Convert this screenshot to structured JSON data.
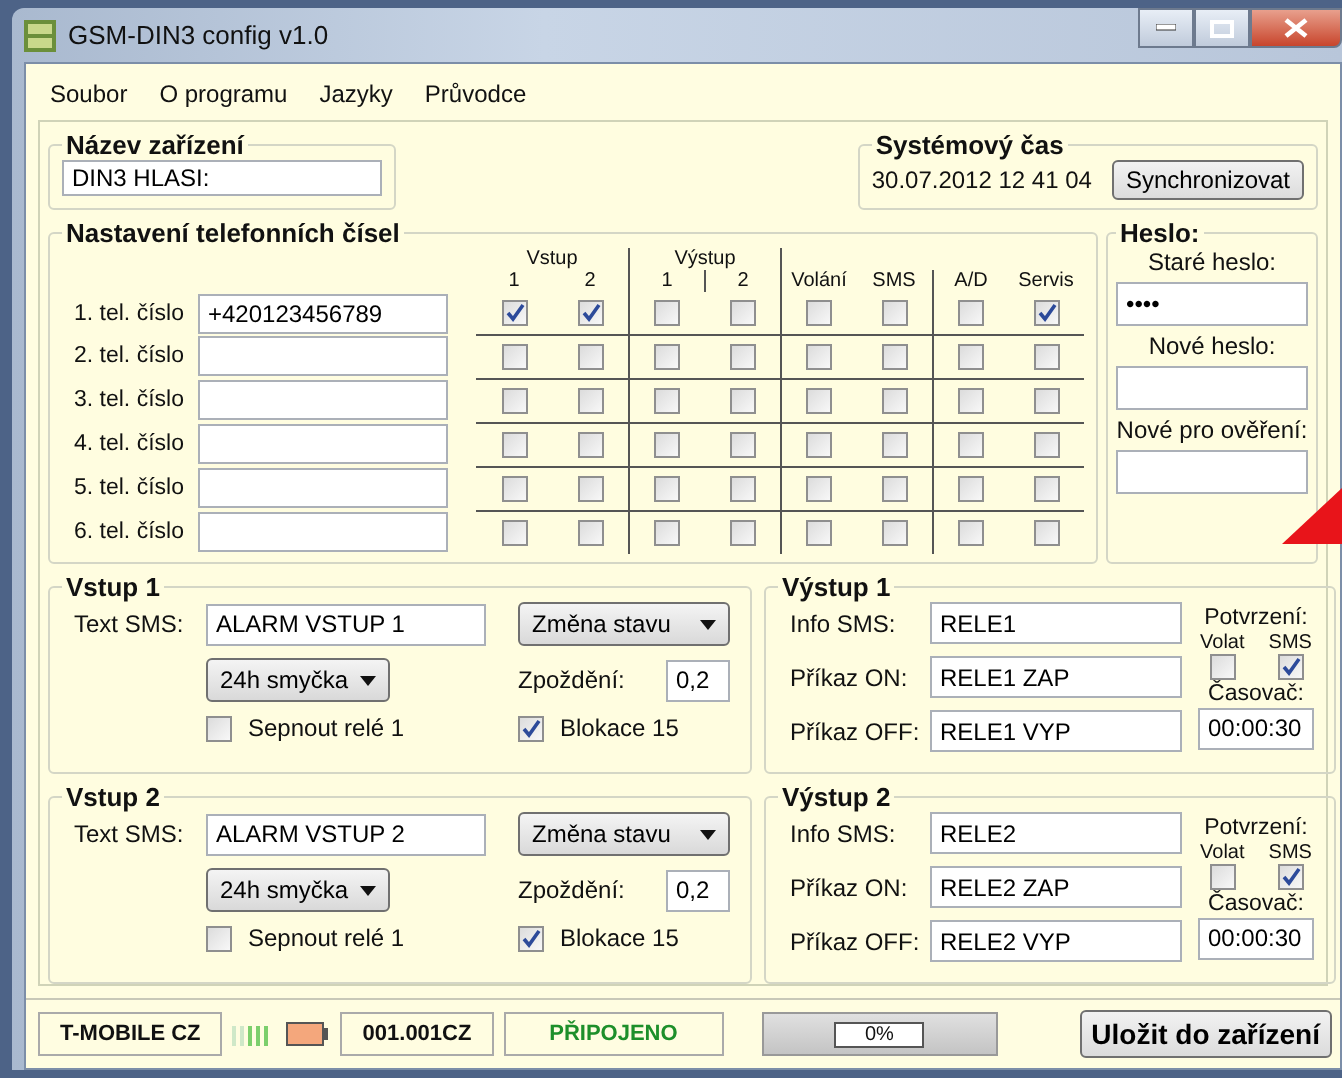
{
  "window": {
    "title": "GSM-DIN3 config v1.0"
  },
  "menu": [
    "Soubor",
    "O programu",
    "Jazyky",
    "Průvodce"
  ],
  "device_name": {
    "title": "Název zařízení",
    "value": "DIN3 HLASI:"
  },
  "system_time": {
    "title": "Systémový čas",
    "value": "30.07.2012 12 41 04",
    "button": "Synchronizovat"
  },
  "phones": {
    "title": "Nastavení telefonních čísel",
    "groups": [
      "Vstup",
      "Výstup"
    ],
    "columns": [
      "1",
      "2",
      "1",
      "2",
      "Volání",
      "SMS",
      "A/D",
      "Servis"
    ],
    "rows": [
      {
        "label": "1. tel. číslo",
        "number": "+420123456789",
        "checks": [
          true,
          true,
          false,
          false,
          false,
          false,
          false,
          true
        ]
      },
      {
        "label": "2. tel. číslo",
        "checks": [
          false,
          false,
          false,
          false,
          false,
          false,
          false,
          false
        ]
      },
      {
        "label": "3. tel. číslo",
        "checks": [
          false,
          false,
          false,
          false,
          false,
          false,
          false,
          false
        ]
      },
      {
        "label": "4. tel. číslo",
        "checks": [
          false,
          false,
          false,
          false,
          false,
          false,
          false,
          false
        ]
      },
      {
        "label": "5. tel. číslo",
        "checks": [
          false,
          false,
          false,
          false,
          false,
          false,
          false,
          false
        ]
      },
      {
        "label": "6. tel. číslo",
        "checks": [
          false,
          false,
          false,
          false,
          false,
          false,
          false,
          false
        ]
      }
    ]
  },
  "password": {
    "title": "Heslo:",
    "fields": [
      {
        "label": "Staré heslo:",
        "value": "••••"
      },
      {
        "label": "Nové heslo:"
      },
      {
        "label": "Nové pro ověření:"
      }
    ]
  },
  "inputs": [
    {
      "title": "Vstup 1",
      "text_label": "Text SMS:",
      "text": "ALARM VSTUP 1",
      "mode": "Změna stavu",
      "loop": "24h smyčka",
      "delay_label": "Zpoždění:",
      "delay": "0,2",
      "relay_label": "Sepnout relé 1",
      "relay_checked": false,
      "block_label": "Blokace 15",
      "block_checked": true
    },
    {
      "title": "Vstup 2",
      "text_label": "Text SMS:",
      "text": "ALARM VSTUP 2",
      "mode": "Změna stavu",
      "loop": "24h smyčka",
      "delay_label": "Zpoždění:",
      "delay": "0,2",
      "relay_label": "Sepnout relé 1",
      "relay_checked": false,
      "block_label": "Blokace 15",
      "block_checked": true
    }
  ],
  "outputs": [
    {
      "title": "Výstup 1",
      "info_label": "Info SMS:",
      "info": "RELE1",
      "on_label": "Příkaz ON:",
      "on": "RELE1 ZAP",
      "off_label": "Příkaz OFF:",
      "off": "RELE1 VYP",
      "confirm_label": "Potvrzení:",
      "call_label": "Volat",
      "sms_label": "SMS",
      "call_checked": false,
      "sms_checked": true,
      "timer_label": "Časovač:",
      "timer": "00:00:30"
    },
    {
      "title": "Výstup 2",
      "info_label": "Info SMS:",
      "info": "RELE2",
      "on_label": "Příkaz ON:",
      "on": "RELE2 ZAP",
      "off_label": "Příkaz OFF:",
      "off": "RELE2 VYP",
      "confirm_label": "Potvrzení:",
      "call_label": "Volat",
      "sms_label": "SMS",
      "call_checked": false,
      "sms_checked": true,
      "timer_label": "Časovač:",
      "timer": "00:00:30"
    }
  ],
  "status_bar": {
    "operator": "T-MOBILE CZ",
    "network": "001.001CZ",
    "connection": "PŘIPOJENO",
    "progress": {
      "level": 0,
      "reading": "0%"
    },
    "save_button": "Uložit do zařízení"
  }
}
